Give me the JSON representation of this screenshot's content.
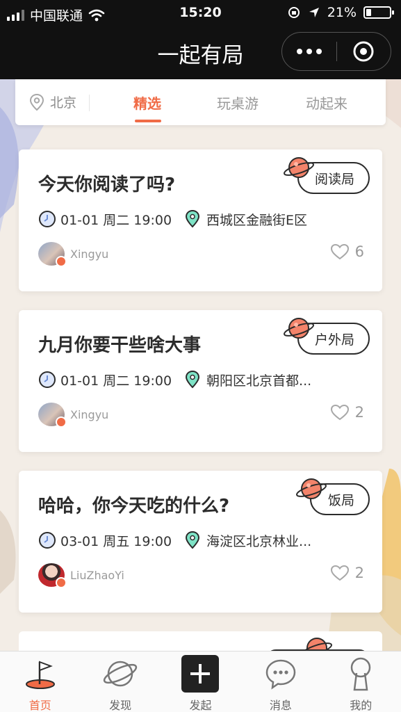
{
  "status_bar": {
    "carrier": "中国联通",
    "time": "15:20",
    "battery": "21%",
    "battery_level": 0.21
  },
  "header": {
    "title": "一起有局"
  },
  "filter": {
    "city": "北京",
    "tabs": [
      {
        "label": "精选",
        "active": true
      },
      {
        "label": "玩桌游",
        "active": false
      },
      {
        "label": "动起来",
        "active": false
      }
    ]
  },
  "events": [
    {
      "title": "今天你阅读了吗?",
      "category": "阅读局",
      "date": "01-01 周二 19:00",
      "location": "西城区金融街E区",
      "author": "Xingyu",
      "likes": "6"
    },
    {
      "title": "九月你要干些啥大事",
      "category": "户外局",
      "date": "01-01 周二 19:00",
      "location": "朝阳区北京首都...",
      "author": "Xingyu",
      "likes": "2"
    },
    {
      "title": "哈哈，你今天吃的什么?",
      "category": "饭局",
      "date": "03-01 周五 19:00",
      "location": "海淀区北京林业...",
      "author": "LiuZhaoYi",
      "likes": "2"
    }
  ],
  "bottom_nav": [
    {
      "label": "首页",
      "icon": "flag-icon",
      "active": true
    },
    {
      "label": "发现",
      "icon": "planet-icon",
      "active": false
    },
    {
      "label": "发起",
      "icon": "plus-icon",
      "active": false
    },
    {
      "label": "消息",
      "icon": "chat-icon",
      "active": false
    },
    {
      "label": "我的",
      "icon": "profile-icon",
      "active": false
    }
  ],
  "colors": {
    "accent": "#f06b46",
    "header_bg": "#111111",
    "page_bg": "#f3ede6",
    "location_icon": "#3ec8a3",
    "clock_icon": "#6d8ed6"
  }
}
